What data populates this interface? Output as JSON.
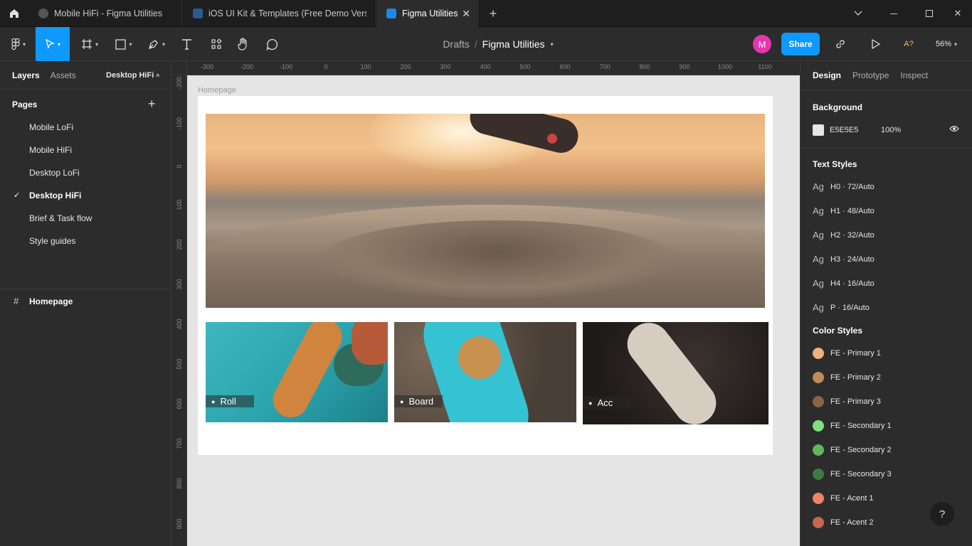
{
  "browser_tabs": [
    {
      "title": "Mobile HiFi - Figma Utilities",
      "active": false
    },
    {
      "title": "iOS UI Kit & Templates (Free Demo Version)",
      "active": false
    },
    {
      "title": "Figma Utilities",
      "active": true
    }
  ],
  "toolbar": {
    "breadcrumb_parent": "Drafts",
    "breadcrumb_sep": "/",
    "file_name": "Figma Utilities",
    "avatar_letter": "M",
    "share_label": "Share",
    "font_missing_label": "A?",
    "zoom": "56%"
  },
  "left_panel": {
    "tab_layers": "Layers",
    "tab_assets": "Assets",
    "current_page": "Desktop HiFi",
    "pages_title": "Pages",
    "pages": [
      {
        "label": "Mobile LoFi",
        "selected": false
      },
      {
        "label": "Mobile HiFi",
        "selected": false
      },
      {
        "label": "Desktop LoFi",
        "selected": false
      },
      {
        "label": "Desktop HiFi",
        "selected": true
      },
      {
        "label": "Brief & Task flow",
        "selected": false
      },
      {
        "label": "Style guides",
        "selected": false
      }
    ],
    "layers": [
      {
        "label": "Homepage"
      }
    ]
  },
  "rulers": {
    "x": [
      "-300",
      "-200",
      "-100",
      "0",
      "100",
      "200",
      "300",
      "400",
      "500",
      "600",
      "700",
      "800",
      "900",
      "1000",
      "1100"
    ],
    "y": [
      "-200",
      "-100",
      "0",
      "100",
      "200",
      "300",
      "400",
      "500",
      "600",
      "700",
      "800",
      "900"
    ]
  },
  "canvas": {
    "frame_label": "Homepage",
    "cards": [
      {
        "label": "Roll"
      },
      {
        "label": "Board"
      },
      {
        "label": "Acc"
      }
    ]
  },
  "right_panel": {
    "tab_design": "Design",
    "tab_prototype": "Prototype",
    "tab_inspect": "Inspect",
    "background_title": "Background",
    "background_hex": "E5E5E5",
    "background_opacity": "100%",
    "text_styles_title": "Text Styles",
    "text_styles": [
      {
        "ag": "Ag",
        "label": "H0 · 72/Auto"
      },
      {
        "ag": "Ag",
        "label": "H1 · 48/Auto"
      },
      {
        "ag": "Ag",
        "label": "H2 · 32/Auto"
      },
      {
        "ag": "Ag",
        "label": "H3 · 24/Auto"
      },
      {
        "ag": "Ag",
        "label": "H4 · 16/Auto"
      },
      {
        "ag": "Ag",
        "label": "P · 16/Auto"
      }
    ],
    "color_styles_title": "Color Styles",
    "color_styles": [
      {
        "label": "FE - Primary 1",
        "color": "#f0b07a"
      },
      {
        "label": "FE - Primary 2",
        "color": "#c08c5a"
      },
      {
        "label": "FE - Primary 3",
        "color": "#8a6448"
      },
      {
        "label": "FE - Secondary 1",
        "color": "#7fe07f"
      },
      {
        "label": "FE - Secondary 2",
        "color": "#5cb85c"
      },
      {
        "label": "FE - Secondary 3",
        "color": "#3f7a45"
      },
      {
        "label": "FE - Acent 1",
        "color": "#ee8266"
      },
      {
        "label": "FE - Acent 2",
        "color": "#c8664e"
      }
    ]
  },
  "colors": {
    "accent": "#0d99ff",
    "avatar": "#e535ab"
  },
  "help_label": "?"
}
